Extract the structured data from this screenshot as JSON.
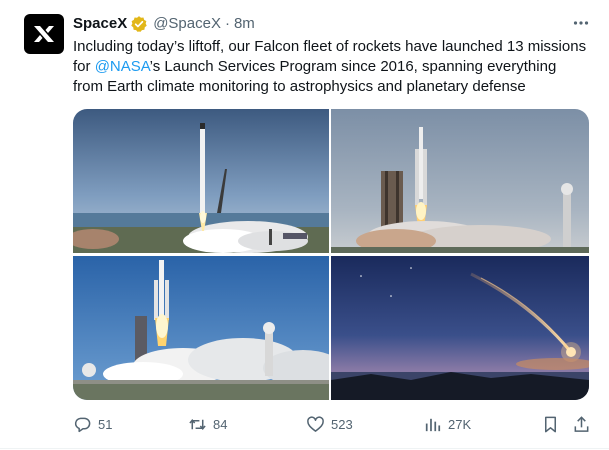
{
  "post": {
    "author_name": "SpaceX",
    "handle": "@SpaceX",
    "separator": "·",
    "time": "8m",
    "verified": true,
    "avatar_icon": "spacex-x-logo",
    "text_before": "Including today’s liftoff, our Falcon fleet of rockets have launched 13 missions for ",
    "mention": "@NASA",
    "text_after": "’s Launch Services Program since 2016, spanning everything from Earth climate monitoring to astrophysics and planetary defense"
  },
  "media": {
    "images": [
      {
        "description_icon": "falcon9-liftoff-photo"
      },
      {
        "description_icon": "falcon-heavy-pad-photo"
      },
      {
        "description_icon": "falcon-heavy-liftoff-photo"
      },
      {
        "description_icon": "night-launch-streak-photo"
      }
    ]
  },
  "actions": {
    "replies": "51",
    "reposts": "84",
    "likes": "523",
    "views": "27K"
  },
  "colors": {
    "accent": "#1d9bf0",
    "verified_badge": "#e2b719",
    "muted": "#536471"
  }
}
